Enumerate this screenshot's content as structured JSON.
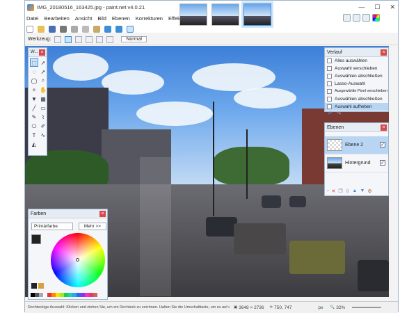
{
  "window": {
    "title": "IMG_20180516_163425.jpg - paint.net v4.0.21"
  },
  "menu": [
    "Datei",
    "Bearbeiten",
    "Ansicht",
    "Bild",
    "Ebenen",
    "Korrekturen",
    "Effekte"
  ],
  "toolbar": {
    "tool_label": "Werkzeug:",
    "blend_mode": "Normal"
  },
  "history_panel": {
    "title": "Verlauf",
    "items": [
      {
        "label": "Alles auswählen",
        "state": "normal"
      },
      {
        "label": "Auswahl verschieben",
        "state": "normal"
      },
      {
        "label": "Auswählen abschließen",
        "state": "normal"
      },
      {
        "label": "Lasso-Auswahl",
        "state": "normal"
      },
      {
        "label": "Ausgewählte Pixel verschieben",
        "state": "normal"
      },
      {
        "label": "Auswählen abschließen",
        "state": "normal"
      },
      {
        "label": "Auswahl aufheben",
        "state": "selected"
      }
    ]
  },
  "layers_panel": {
    "title": "Ebenen",
    "layers": [
      {
        "name": "Ebene 2",
        "visible": true,
        "selected": true
      },
      {
        "name": "Hintergrund",
        "visible": true,
        "selected": false
      }
    ]
  },
  "tools_panel": {
    "title": "W..."
  },
  "colors_panel": {
    "title": "Farben",
    "primary_dropdown": "Primärfarbe",
    "more_button": "Mehr >>"
  },
  "status": {
    "hint": "Rechteckige Auswahl: Klicken und ziehen Sie, um ein Rechteck zu zeichnen. Halten Sie die Umschalttaste, um es auf ein Quadrat zu beschränken.",
    "image_size": "3648 × 2736",
    "cursor_pos": "750, 747",
    "unit": "px",
    "zoom": "32%"
  },
  "colors": {
    "accent": "#3c8fd6",
    "selection": "#b8d6f3"
  }
}
